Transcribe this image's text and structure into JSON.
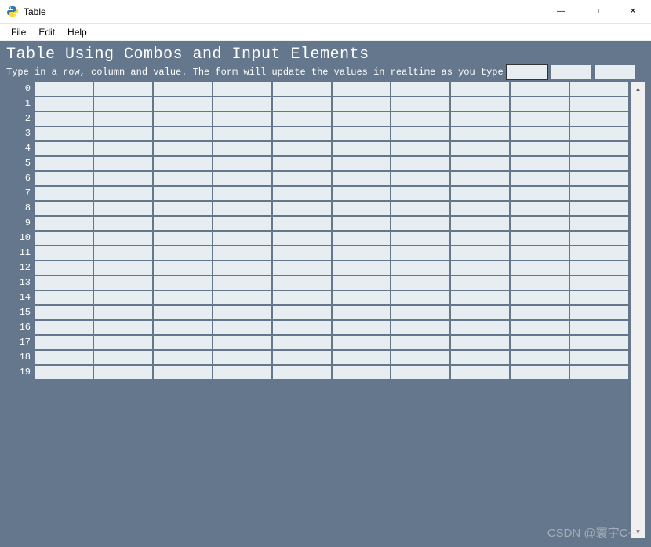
{
  "window": {
    "title": "Table"
  },
  "menubar": {
    "items": [
      "File",
      "Edit",
      "Help"
    ]
  },
  "content": {
    "heading": "Table Using Combos and Input Elements",
    "instruction": "Type in a row, column and value. The form will update the values in realtime as you type",
    "header_inputs": {
      "row": "",
      "column": "",
      "value": ""
    }
  },
  "table": {
    "rows": 20,
    "cols": 10,
    "row_labels": [
      "0",
      "1",
      "2",
      "3",
      "4",
      "5",
      "6",
      "7",
      "8",
      "9",
      "10",
      "11",
      "12",
      "13",
      "14",
      "15",
      "16",
      "17",
      "18",
      "19"
    ],
    "data": [
      [
        "",
        "",
        "",
        "",
        "",
        "",
        "",
        "",
        "",
        ""
      ],
      [
        "",
        "",
        "",
        "",
        "",
        "",
        "",
        "",
        "",
        ""
      ],
      [
        "",
        "",
        "",
        "",
        "",
        "",
        "",
        "",
        "",
        ""
      ],
      [
        "",
        "",
        "",
        "",
        "",
        "",
        "",
        "",
        "",
        ""
      ],
      [
        "",
        "",
        "",
        "",
        "",
        "",
        "",
        "",
        "",
        ""
      ],
      [
        "",
        "",
        "",
        "",
        "",
        "",
        "",
        "",
        "",
        ""
      ],
      [
        "",
        "",
        "",
        "",
        "",
        "",
        "",
        "",
        "",
        ""
      ],
      [
        "",
        "",
        "",
        "",
        "",
        "",
        "",
        "",
        "",
        ""
      ],
      [
        "",
        "",
        "",
        "",
        "",
        "",
        "",
        "",
        "",
        ""
      ],
      [
        "",
        "",
        "",
        "",
        "",
        "",
        "",
        "",
        "",
        ""
      ],
      [
        "",
        "",
        "",
        "",
        "",
        "",
        "",
        "",
        "",
        ""
      ],
      [
        "",
        "",
        "",
        "",
        "",
        "",
        "",
        "",
        "",
        ""
      ],
      [
        "",
        "",
        "",
        "",
        "",
        "",
        "",
        "",
        "",
        ""
      ],
      [
        "",
        "",
        "",
        "",
        "",
        "",
        "",
        "",
        "",
        ""
      ],
      [
        "",
        "",
        "",
        "",
        "",
        "",
        "",
        "",
        "",
        ""
      ],
      [
        "",
        "",
        "",
        "",
        "",
        "",
        "",
        "",
        "",
        ""
      ],
      [
        "",
        "",
        "",
        "",
        "",
        "",
        "",
        "",
        "",
        ""
      ],
      [
        "",
        "",
        "",
        "",
        "",
        "",
        "",
        "",
        "",
        ""
      ],
      [
        "",
        "",
        "",
        "",
        "",
        "",
        "",
        "",
        "",
        ""
      ],
      [
        "",
        "",
        "",
        "",
        "",
        "",
        "",
        "",
        "",
        ""
      ]
    ]
  },
  "colors": {
    "content_bg": "#64778d",
    "cell_bg": "#e8edf2",
    "text_light": "#ffffff"
  },
  "watermark": "CSDN @寰宇C++"
}
